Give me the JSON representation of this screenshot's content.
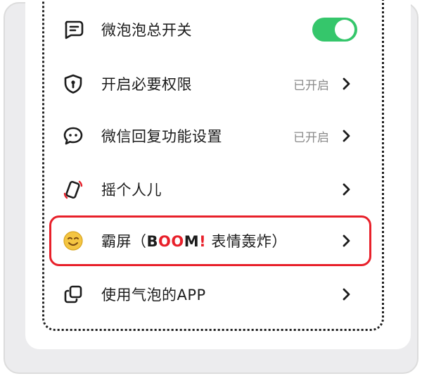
{
  "settings": {
    "items": [
      {
        "icon": "message-icon",
        "label": "微泡泡总开关",
        "toggle_on": true
      },
      {
        "icon": "shield-icon",
        "label": "开启必要权限",
        "status": "已开启"
      },
      {
        "icon": "chat-bubble-icon",
        "label": "微信回复功能设置",
        "status": "已开启"
      },
      {
        "icon": "phone-shake-icon",
        "label": "摇个人儿"
      },
      {
        "icon": "emoji-face-icon",
        "label_prefix": "霸屏（",
        "label_b": "B",
        "label_oo": "OO",
        "label_m": "M",
        "label_excl": "!",
        "label_suffix": " 表情轰炸）"
      },
      {
        "icon": "copy-icon",
        "label": "使用气泡的APP"
      }
    ]
  },
  "colors": {
    "toggle_on": "#35c66b",
    "highlight_border": "#e8202a",
    "accent_red": "#e8202a",
    "status_gray": "#8a8a8a"
  }
}
